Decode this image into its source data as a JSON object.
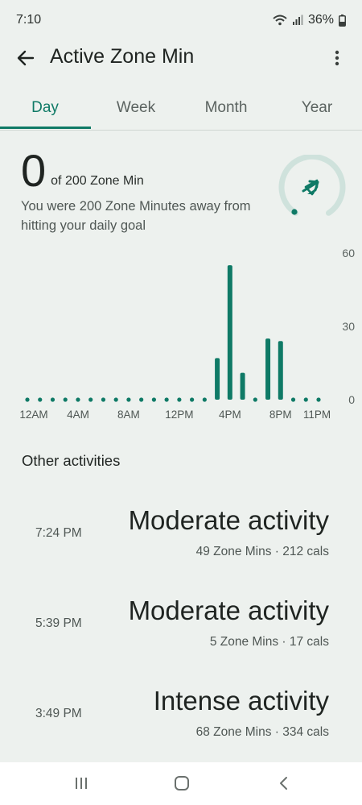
{
  "status": {
    "time": "7:10",
    "battery": "36%",
    "icons": [
      "wifi-icon",
      "signal-icon",
      "battery-icon"
    ]
  },
  "app_bar": {
    "title": "Active Zone Min",
    "icons": [
      "back-arrow-icon",
      "more-vert-icon"
    ]
  },
  "tabs": [
    {
      "label": "Day",
      "active": true
    },
    {
      "label": "Week",
      "active": false
    },
    {
      "label": "Month",
      "active": false
    },
    {
      "label": "Year",
      "active": false
    }
  ],
  "summary": {
    "value": "0",
    "goal_text": "of 200 Zone Min",
    "description": "You were 200 Zone Minutes away from hitting your daily goal",
    "progress": 0
  },
  "colors": {
    "accent": "#0f7a66",
    "ring_track": "#cfe2dc",
    "background": "#edf1ee"
  },
  "chart_data": {
    "type": "bar",
    "x_ticks": [
      "12AM",
      "4AM",
      "8AM",
      "12PM",
      "4PM",
      "8PM",
      "11PM"
    ],
    "y_ticks": [
      "60",
      "30",
      "0"
    ],
    "ylim": [
      0,
      60
    ],
    "categories": [
      "12AM",
      "1AM",
      "2AM",
      "3AM",
      "4AM",
      "5AM",
      "6AM",
      "7AM",
      "8AM",
      "9AM",
      "10AM",
      "11AM",
      "12PM",
      "1PM",
      "2PM",
      "3PM",
      "4PM",
      "5PM",
      "6PM",
      "7PM",
      "8PM",
      "9PM",
      "10PM",
      "11PM"
    ],
    "values": [
      0,
      0,
      0,
      0,
      0,
      0,
      0,
      0,
      0,
      0,
      0,
      0,
      0,
      0,
      0,
      17,
      55,
      11,
      0,
      25,
      24,
      0,
      0,
      0
    ]
  },
  "other_activities": {
    "title": "Other activities",
    "items": [
      {
        "time": "7:24 PM",
        "name": "Moderate activity",
        "details": "49 Zone Mins · 212 cals"
      },
      {
        "time": "5:39 PM",
        "name": "Moderate activity",
        "details": "5 Zone Mins · 17 cals"
      },
      {
        "time": "3:49 PM",
        "name": "Intense activity",
        "details": "68 Zone Mins · 334 cals"
      }
    ]
  },
  "nav": {
    "icons": [
      "recent-apps-icon",
      "home-icon",
      "back-icon"
    ]
  }
}
